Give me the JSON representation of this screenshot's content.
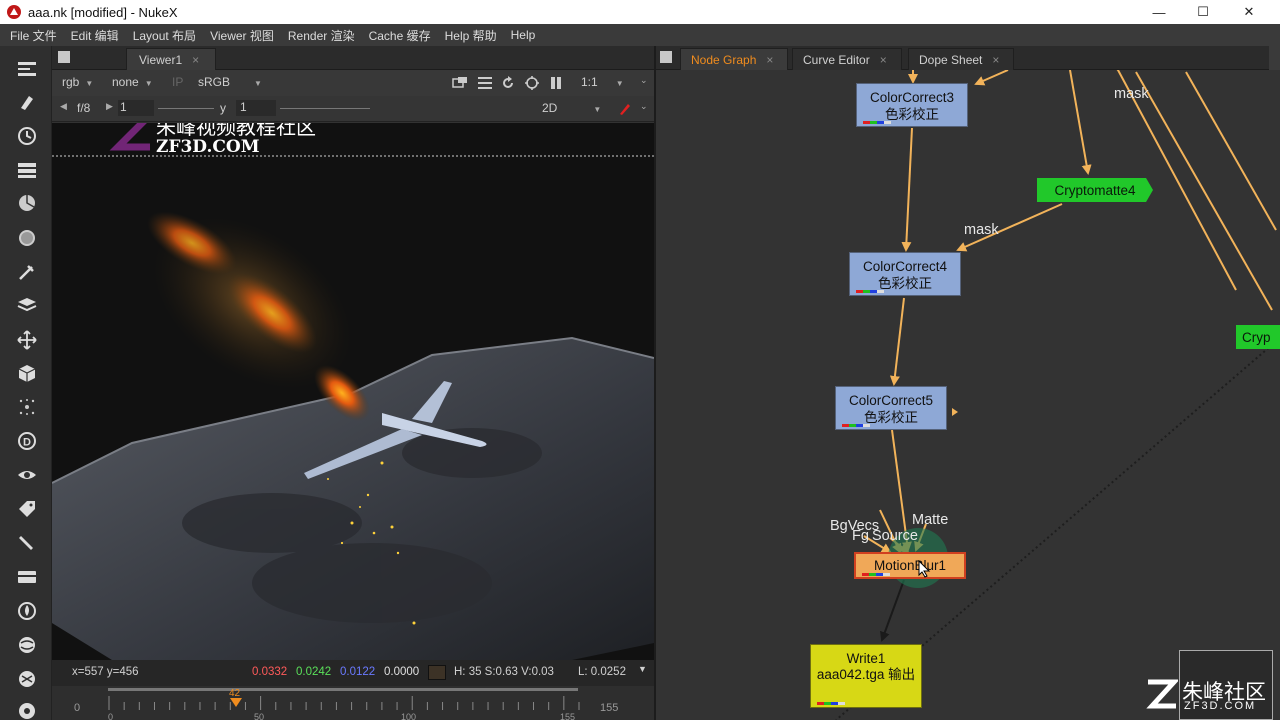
{
  "window": {
    "title": "aaa.nk [modified] - NukeX",
    "minimize": "—",
    "maximize": "☐",
    "close": "✕"
  },
  "menu": [
    "File 文件",
    "Edit 编辑",
    "Layout 布局",
    "Viewer 视图",
    "Render 渲染",
    "Cache 缓存",
    "Help 帮助",
    "Help"
  ],
  "toolbar_icons": [
    "viewer-icon",
    "paint-icon",
    "time-icon",
    "channel-icon",
    "color-icon",
    "filter-icon",
    "keyer-icon",
    "merge-icon",
    "transform-icon",
    "3d-icon",
    "particles-icon",
    "deep-icon",
    "views-icon",
    "metadata-icon",
    "toolsets-icon",
    "other-icon",
    "furnace-icon",
    "ocula-icon",
    "cara-icon"
  ],
  "viewer": {
    "tab": "Viewer1",
    "tab_close": "×",
    "channels": "rgb",
    "mask": "none",
    "ip": "IP",
    "lut": "sRGB",
    "zoom": "1:1",
    "fstop": "f/8",
    "gain": "1",
    "gamma_label": "y",
    "gamma": "1",
    "mode": "2D",
    "info": {
      "coords": "x=557 y=456",
      "r": "0.0332",
      "g": "0.0242",
      "b": "0.0122",
      "a": "0.0000",
      "hsv": "H: 35 S:0.63 V:0.03",
      "lum": "L: 0.0252"
    },
    "timeline": {
      "start": "0",
      "end": "155",
      "current": "42",
      "ticks": [
        "0",
        "50",
        "100",
        "155"
      ]
    }
  },
  "watermark": {
    "cn": "朱峰视频教程社区",
    "en": "ZF3D.COM",
    "br_cn": "朱峰社区",
    "br_en": "ZF3D.COM"
  },
  "node_graph": {
    "tabs": [
      {
        "label": "Node Graph",
        "close": "×",
        "active": true
      },
      {
        "label": "Curve Editor",
        "close": "×",
        "active": false
      },
      {
        "label": "Dope Sheet",
        "close": "×",
        "active": false
      }
    ],
    "nodes": {
      "cc3": {
        "name": "ColorCorrect3",
        "sub": "色彩校正"
      },
      "cc4": {
        "name": "ColorCorrect4",
        "sub": "色彩校正"
      },
      "cc5": {
        "name": "ColorCorrect5",
        "sub": "色彩校正"
      },
      "crypto4": {
        "name": "Cryptomatte4"
      },
      "crypto_partial": {
        "name": "Cryp"
      },
      "motionblur": {
        "name": "MotionBlur1"
      },
      "write": {
        "name": "Write1",
        "file": "aaa042.tga",
        "sub": "输出"
      }
    },
    "labels": {
      "mask1": "mask",
      "mask2": "mask",
      "bgvecs": "BgVecs",
      "fgvecs": "Fg",
      "source": "Source",
      "matte": "Matte"
    }
  },
  "colors": {
    "accent": "#f08c1e",
    "pipe": "#f2b35a",
    "cc_node": "#8ea8d6",
    "crypto_node": "#21c82a",
    "write_node": "#d7d815"
  }
}
